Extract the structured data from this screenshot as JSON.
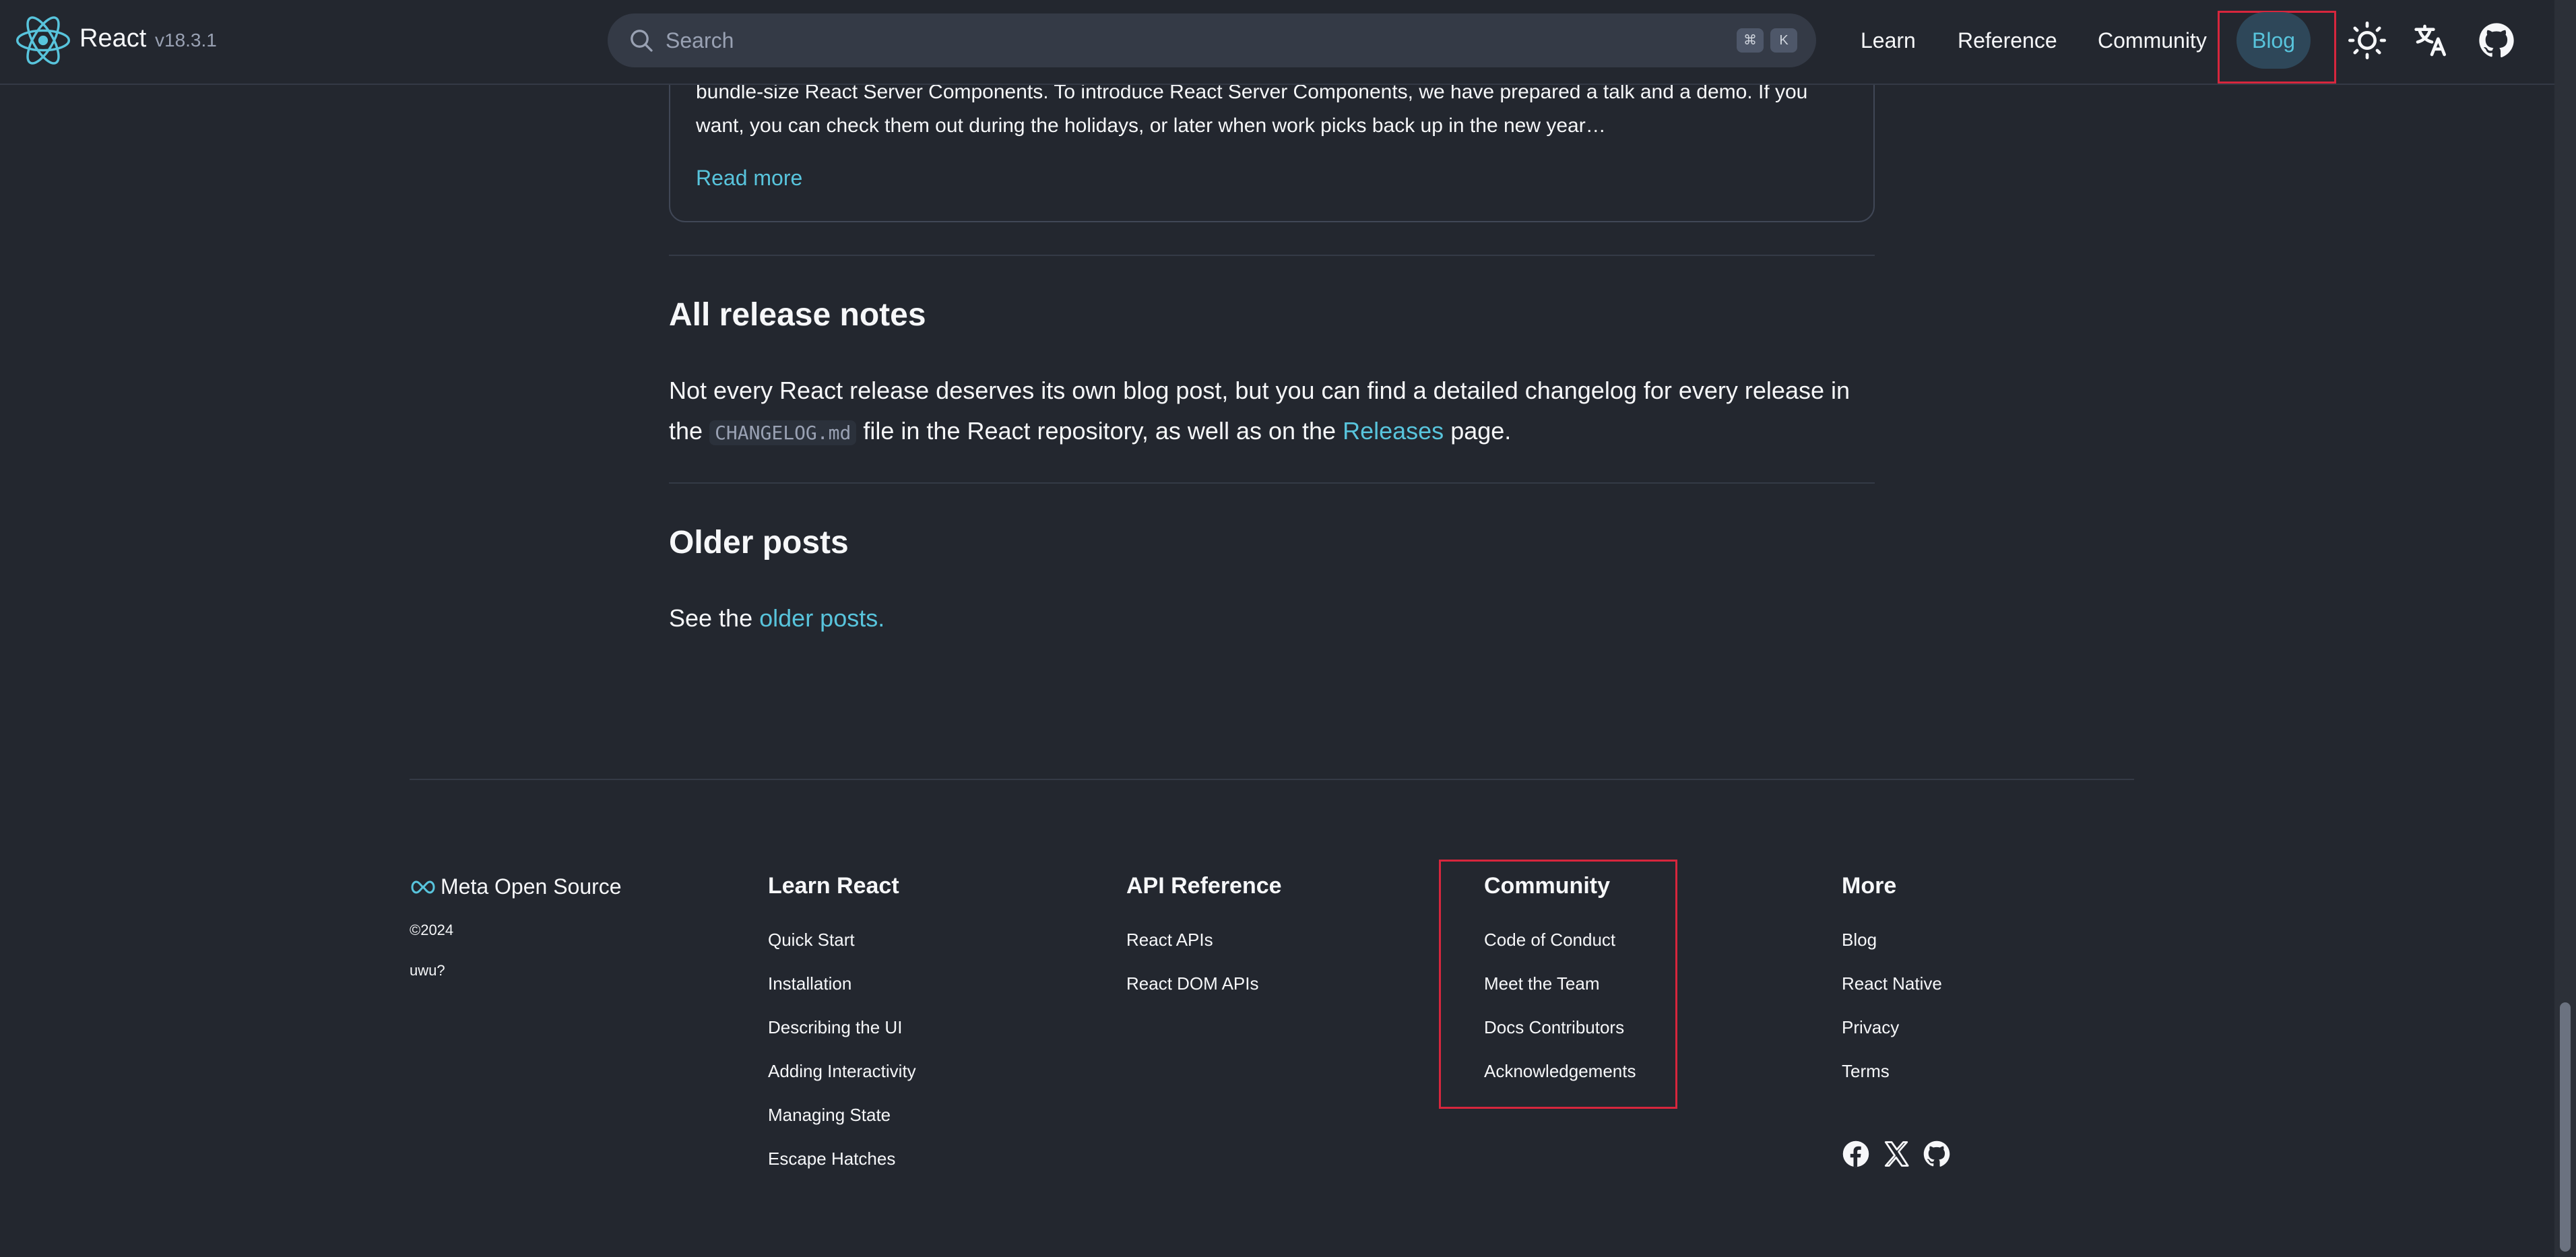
{
  "header": {
    "logo_text": "React",
    "version": "v18.3.1",
    "search_placeholder": "Search",
    "kbd1": "⌘",
    "kbd2": "K",
    "nav": [
      "Learn",
      "Reference",
      "Community",
      "Blog"
    ],
    "icons": [
      "theme-toggle-icon",
      "language-icon",
      "github-icon"
    ]
  },
  "card": {
    "text": "bundle-size React Server Components. To introduce React Server Components, we have prepared a talk and a demo. If you want, you can check them out during the holidays, or later when work picks back up in the new year…",
    "read_more": "Read more"
  },
  "release_notes": {
    "title": "All release notes",
    "p1": "Not every React release deserves its own blog post, but you can find a detailed changelog for every release in the",
    "code": "CHANGELOG.md",
    "p2": "file in the React repository, as well as on the",
    "releases_link": "Releases",
    "p3": "page."
  },
  "older_posts": {
    "title": "Older posts",
    "prefix": "See the",
    "link": "older posts."
  },
  "footer": {
    "brand": "Meta Open Source",
    "copyright": "©2024",
    "uwu": "uwu?",
    "columns": [
      {
        "title": "Learn React",
        "links": [
          "Quick Start",
          "Installation",
          "Describing the UI",
          "Adding Interactivity",
          "Managing State",
          "Escape Hatches"
        ]
      },
      {
        "title": "API Reference",
        "links": [
          "React APIs",
          "React DOM APIs"
        ]
      },
      {
        "title": "Community",
        "links": [
          "Code of Conduct",
          "Meet the Team",
          "Docs Contributors",
          "Acknowledgements"
        ]
      },
      {
        "title": "More",
        "links": [
          "Blog",
          "React Native",
          "Privacy",
          "Terms"
        ]
      }
    ],
    "social_icons": [
      "facebook-icon",
      "x-icon",
      "github-icon"
    ]
  },
  "colors": {
    "background": "#23272f",
    "accent": "#58c4dc",
    "highlight_border": "#d7263d"
  }
}
